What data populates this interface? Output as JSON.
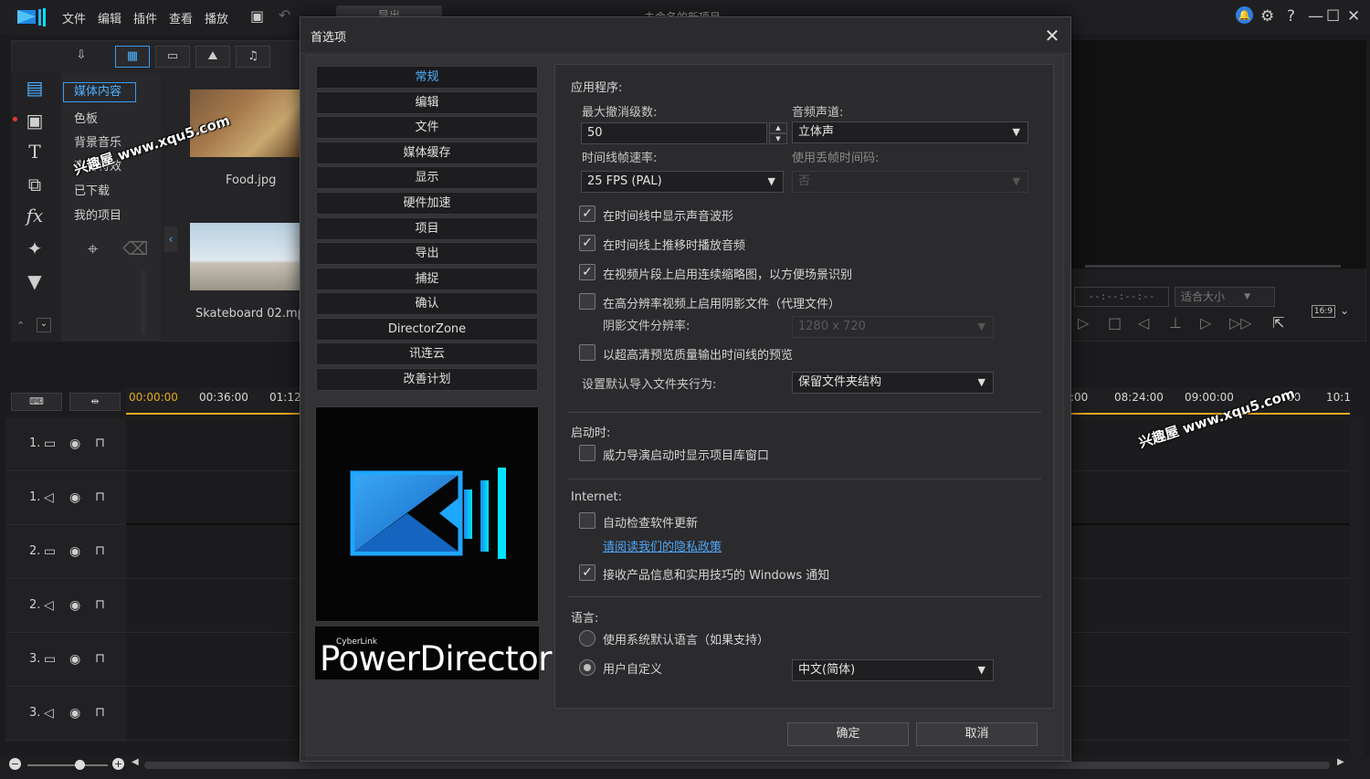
{
  "menubar": {
    "items": [
      "文件",
      "编辑",
      "插件",
      "查看",
      "播放"
    ],
    "export_tab": "导出",
    "project_title": "未命名的新项目"
  },
  "library": {
    "items": [
      "媒体内容",
      "色板",
      "背景音乐",
      "声音特效",
      "已下载",
      "我的项目"
    ],
    "media": [
      {
        "label": "Food.jpg"
      },
      {
        "label": "Skateboard 02.mp"
      }
    ]
  },
  "preview": {
    "timecode": "--:--:--:--",
    "fit": "适合大小",
    "aspect": "16:9"
  },
  "timeline": {
    "ruler_left": [
      "00:00:00",
      "00:36:00",
      "01:12"
    ],
    "ruler_right": [
      ":00",
      "08:24:00",
      "09:00:00",
      ":00",
      "10:1"
    ],
    "tracks": [
      "1.",
      "1.",
      "2.",
      "2.",
      "3.",
      "3."
    ]
  },
  "watermark": "兴趣屋 www.xqu5.com",
  "dialog": {
    "title": "首选项",
    "nav": [
      "常规",
      "编辑",
      "文件",
      "媒体缓存",
      "显示",
      "硬件加速",
      "项目",
      "导出",
      "捕捉",
      "确认",
      "DirectorZone",
      "讯连云",
      "改善计划"
    ],
    "brand_small": "CyberLink",
    "brand_name": "PowerDirector",
    "application": {
      "heading": "应用程序:",
      "max_undo_label": "最大撤消级数:",
      "max_undo_value": "50",
      "audio_channel_label": "音频声道:",
      "audio_channel_value": "立体声",
      "timeline_fps_label": "时间线帧速率:",
      "timeline_fps_value": "25 FPS (PAL)",
      "drop_frame_label": "使用丢帧时间码:",
      "drop_frame_value": "否",
      "options": [
        {
          "label": "在时间线中显示声音波形",
          "checked": true
        },
        {
          "label": "在时间线上推移时播放音频",
          "checked": true
        },
        {
          "label": "在视频片段上启用连续缩略图，以方便场景识别",
          "checked": true
        },
        {
          "label": "在高分辨率视频上启用阴影文件（代理文件）",
          "checked": false
        }
      ],
      "shadow_res_label": "阴影文件分辨率:",
      "shadow_res_value": "1280 x 720",
      "hq_preview_label": "以超高清预览质量输出时间线的预览",
      "default_import_label": "设置默认导入文件夹行为:",
      "default_import_value": "保留文件夹结构"
    },
    "startup": {
      "heading": "启动时:",
      "show_library_label": "威力导演启动时显示项目库窗口"
    },
    "internet": {
      "heading": "Internet:",
      "auto_update_label": "自动检查软件更新",
      "privacy_link": "请阅读我们的隐私政策",
      "receive_info_label": "接收产品信息和实用技巧的 Windows 通知"
    },
    "language": {
      "heading": "语言:",
      "system_default_label": "使用系统默认语言（如果支持）",
      "custom_label": "用户自定义",
      "custom_value": "中文(简体)"
    },
    "ok_label": "确定",
    "cancel_label": "取消"
  },
  "colors": {
    "accent": "#4fb0ff",
    "timeline_marker": "#e5a91f"
  }
}
